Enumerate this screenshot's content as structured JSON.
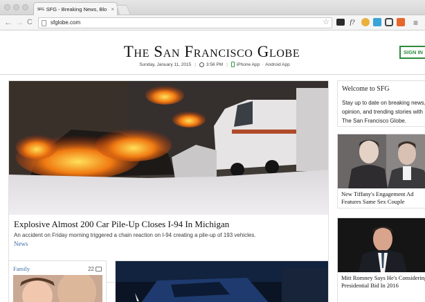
{
  "browser": {
    "tab_favicon_text": "SFG",
    "tab_title": "SFG - Breaking News, Blo",
    "tab_close": "×",
    "back_icon": "←",
    "forward_icon": "→",
    "reload_icon": "C",
    "address": "sfglobe.com",
    "bookmark_icon": "☆",
    "ext_f_label": "f?",
    "menu_icon": "≡"
  },
  "site": {
    "logo": "The San Francisco Globe",
    "date": "Sunday, January 11, 2015",
    "time": "3:56 PM",
    "iphone_app": "iPhone App",
    "dot_separator": "·",
    "android_app": "Android App",
    "separator": "|",
    "signin_label": "SIGN IN"
  },
  "hero": {
    "headline": "Explosive Almost 200 Car Pile-Up Closes I-94 In Michigan",
    "summary": "An accident on Friday morning triggered a chain reaction on I-94 creating a pile-up of 193 vehicles.",
    "category": "News"
  },
  "welcome": {
    "title": "Welcome to SFG",
    "text": "Stay up to date on breaking news, opinion, and trending stories with The San Francisco Globe."
  },
  "side_stories": [
    {
      "headline": "New Tiffany's Engagement Ad Features Same Sex Couple"
    },
    {
      "headline": "Mitt Romney Says He's Considering A Presidential Bid In 2016"
    }
  ],
  "family_card": {
    "category": "Family",
    "comment_count": "22"
  },
  "colors": {
    "link_blue": "#3d6fa8",
    "signin_green": "#2e8b3a"
  }
}
